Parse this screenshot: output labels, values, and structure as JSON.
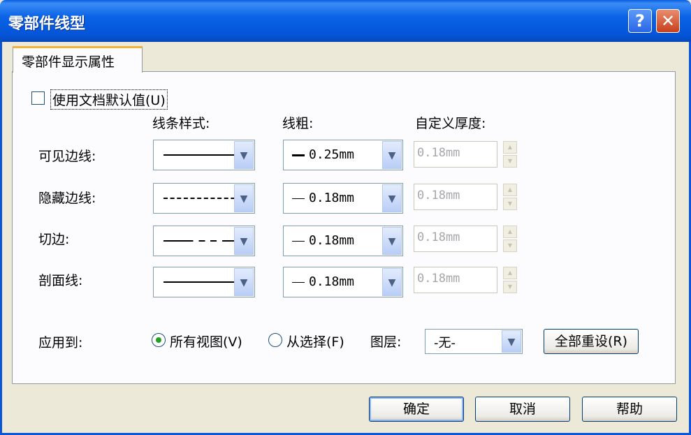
{
  "window": {
    "title": "零部件线型"
  },
  "tabs": [
    {
      "label": "零部件显示属性"
    }
  ],
  "use_doc_defaults": {
    "label": "使用文档默认值(U)",
    "checked": false
  },
  "columns": {
    "style": "线条样式:",
    "weight": "线粗:",
    "thickness": "自定义厚度:"
  },
  "rows": [
    {
      "label": "可见边线:",
      "style": "solid",
      "weight": "0.25mm",
      "thickness": "0.18mm"
    },
    {
      "label": "隐藏边线:",
      "style": "dashed",
      "weight": "0.18mm",
      "thickness": "0.18mm"
    },
    {
      "label": "切边:",
      "style": "chain",
      "weight": "0.18mm",
      "thickness": "0.18mm"
    },
    {
      "label": "剖面线:",
      "style": "solid",
      "weight": "0.18mm",
      "thickness": "0.18mm"
    }
  ],
  "apply": {
    "label": "应用到:",
    "all_views": {
      "label": "所有视图(V)",
      "selected": true
    },
    "from_selection": {
      "label": "从选择(F)",
      "selected": false
    },
    "layer_label": "图层:",
    "layer_value": "-无-",
    "reset_label": "全部重设(R)"
  },
  "buttons": {
    "ok": "确定",
    "cancel": "取消",
    "help": "帮助"
  },
  "title_buttons": {
    "help": "?",
    "close": "✕"
  },
  "colors": {
    "title_bar": "#0a5ee0",
    "radio_dot": "#21a121",
    "tab_highlight": "#f4b23a"
  }
}
